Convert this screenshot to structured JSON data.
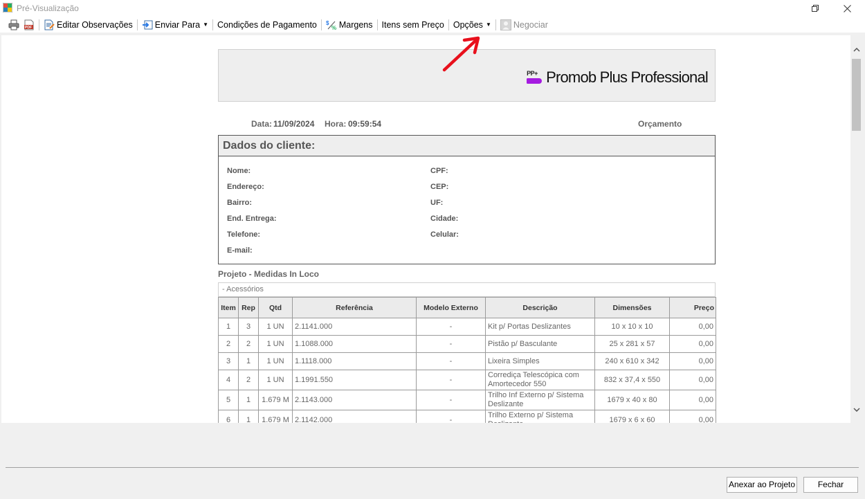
{
  "window": {
    "title": "Pré-Visualização"
  },
  "toolbar": {
    "edit_notes": "Editar Observações",
    "send_to": "Enviar Para",
    "payment_terms": "Condições de Pagamento",
    "margins": "Margens",
    "items_no_price": "Itens sem Preço",
    "options": "Opções",
    "negotiate": "Negociar"
  },
  "report": {
    "brand": "Promob Plus Professional",
    "brand_mark": "PP+",
    "date_label": "Data:",
    "date": "11/09/2024",
    "time_label": "Hora:",
    "time": "09:59:54",
    "doc_type": "Orçamento",
    "client_section": "Dados do cliente:",
    "client_fields_left": [
      "Nome:",
      "Endereço:",
      "Bairro:",
      "End. Entrega:",
      "Telefone:",
      "E-mail:"
    ],
    "client_fields_right": [
      "CPF:",
      "CEP:",
      "UF:",
      "Cidade:",
      "Celular:"
    ],
    "project_title": "Projeto - Medidas In Loco",
    "group": "- Acessórios",
    "columns": [
      "Item",
      "Rep",
      "Qtd",
      "Referência",
      "Modelo Externo",
      "Descrição",
      "Dimensões",
      "Preço"
    ],
    "rows": [
      [
        "1",
        "3",
        "1 UN",
        "2.1141.000",
        "-",
        "Kit p/ Portas Deslizantes",
        "10 x 10 x 10",
        "0,00"
      ],
      [
        "2",
        "2",
        "1 UN",
        "1.1088.000",
        "-",
        "Pistão p/ Basculante",
        "25 x 281 x 57",
        "0,00"
      ],
      [
        "3",
        "1",
        "1 UN",
        "1.1118.000",
        "-",
        "Lixeira Simples",
        "240 x 610 x 342",
        "0,00"
      ],
      [
        "4",
        "2",
        "1 UN",
        "1.1991.550",
        "-",
        "Corrediça Telescópica com Amortecedor 550",
        "832 x 37,4 x 550",
        "0,00"
      ],
      [
        "5",
        "1",
        "1.679 M",
        "2.1143.000",
        "-",
        "Trilho Inf Externo p/ Sistema Deslizante",
        "1679 x 40 x 80",
        "0,00"
      ],
      [
        "6",
        "1",
        "1.679 M",
        "2.1142.000",
        "-",
        "Trilho Externo p/ Sistema Deslizante",
        "1679 x 6 x 60",
        "0,00"
      ]
    ]
  },
  "buttons": {
    "attach": "Anexar ao Projeto",
    "close": "Fechar"
  },
  "colors": {
    "brand_purple": "#a51be0",
    "arrow_red": "#e8101c"
  }
}
